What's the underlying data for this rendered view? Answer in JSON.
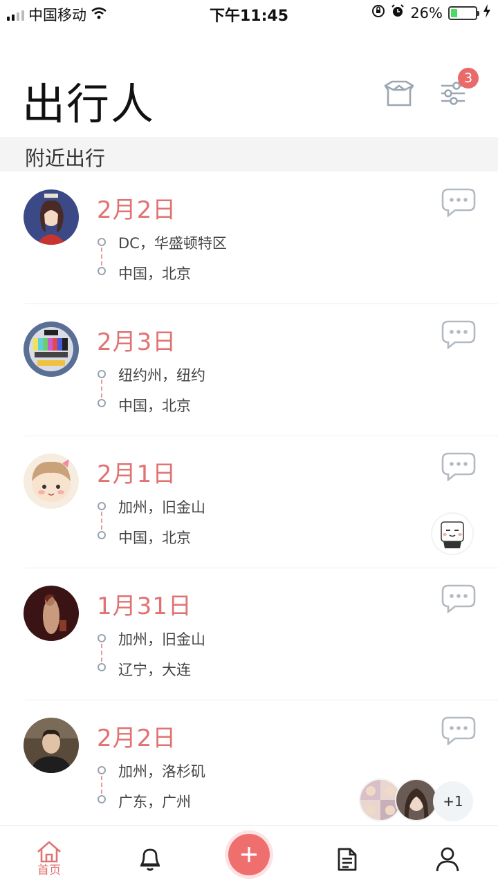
{
  "status_bar": {
    "carrier": "中国移动",
    "time": "下午11:45",
    "battery_percent": "26%",
    "battery_level": 0.26,
    "icons": [
      "signal-icon",
      "wifi-icon",
      "rotation-lock-icon",
      "alarm-icon",
      "battery-icon",
      "charging-icon"
    ]
  },
  "header": {
    "title": "出行人",
    "icons": [
      "box-icon",
      "filter-icon"
    ],
    "filter_badge": "3"
  },
  "section": {
    "title": "附近出行"
  },
  "trips": [
    {
      "date": "2月2日",
      "from": "DC，华盛顿特区",
      "to": "中国，北京",
      "avatar": "cartoon-girl-avatar"
    },
    {
      "date": "2月3日",
      "from": "纽约州，纽约",
      "to": "中国，北京",
      "avatar": "test-pattern-avatar"
    },
    {
      "date": "2月1日",
      "from": "加州，旧金山",
      "to": "中国，北京",
      "avatar": "cartoon-face-avatar",
      "companion": "cartoon-cat-avatar"
    },
    {
      "date": "1月31日",
      "from": "加州，旧金山",
      "to": "辽宁，大连",
      "avatar": "painting-avatar"
    },
    {
      "date": "2月2日",
      "from": "加州，洛杉矶",
      "to": "广东，广州",
      "avatar": "man-photo-avatar",
      "companions_more": "+1"
    }
  ],
  "bottom_nav": {
    "home_label": "首页",
    "accent_color": "#e17272",
    "icons": [
      "home-icon",
      "bell-icon",
      "add-icon",
      "document-icon",
      "profile-icon"
    ]
  },
  "colors": {
    "accent": "#e17272",
    "badge": "#e96a6a",
    "section_bg": "#f4f4f5"
  }
}
